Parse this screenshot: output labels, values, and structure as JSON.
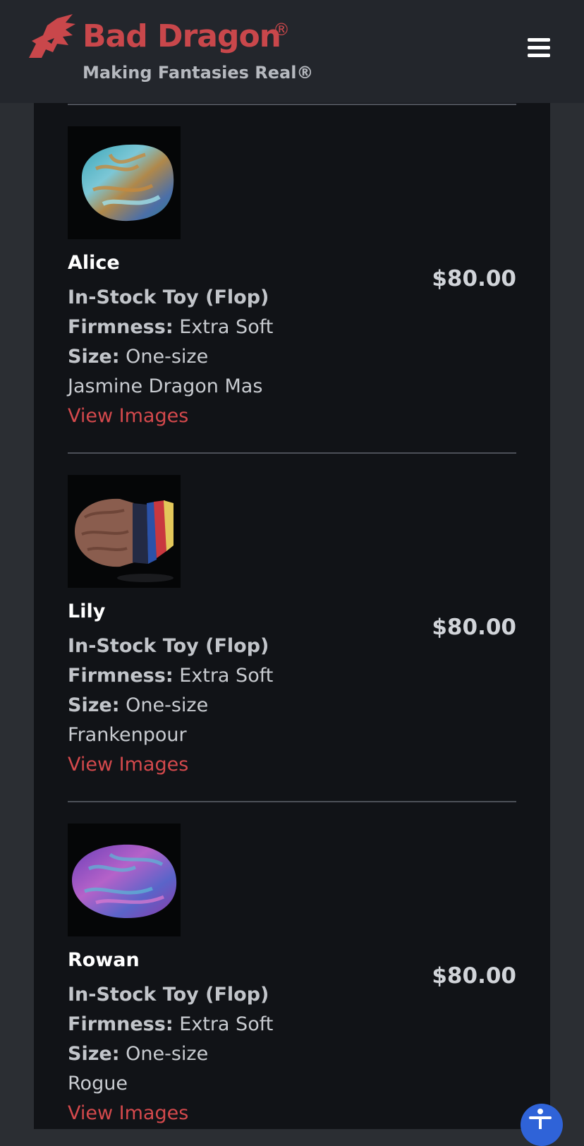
{
  "header": {
    "brand_name": "Bad Dragon",
    "brand_registered": "®",
    "tagline": "Making Fantasies Real®",
    "logo_icon": "dragon-head-icon",
    "menu_icon": "hamburger-icon"
  },
  "colors": {
    "brand_red": "#c9474b",
    "link_red": "#d4494c",
    "header_bg": "#23262c",
    "panel_bg": "#111317",
    "accessibility_blue": "#2f63d8"
  },
  "products": [
    {
      "name": "Alice",
      "price": "$80.00",
      "type": "In-Stock Toy (Flop)",
      "firmness_label": "Firmness:",
      "firmness_value": " Extra Soft",
      "size_label": "Size:",
      "size_value": " One-size",
      "colorway": "Jasmine Dragon Mas",
      "link": "View Images"
    },
    {
      "name": "Lily",
      "price": "$80.00",
      "type": "In-Stock Toy (Flop)",
      "firmness_label": "Firmness:",
      "firmness_value": " Extra Soft",
      "size_label": "Size:",
      "size_value": " One-size",
      "colorway": "Frankenpour",
      "link": "View Images"
    },
    {
      "name": "Rowan",
      "price": "$80.00",
      "type": "In-Stock Toy (Flop)",
      "firmness_label": "Firmness:",
      "firmness_value": " Extra Soft",
      "size_label": "Size:",
      "size_value": " One-size",
      "colorway": "Rogue",
      "link": "View Images"
    }
  ],
  "accessibility": {
    "icon": "accessibility-icon"
  }
}
